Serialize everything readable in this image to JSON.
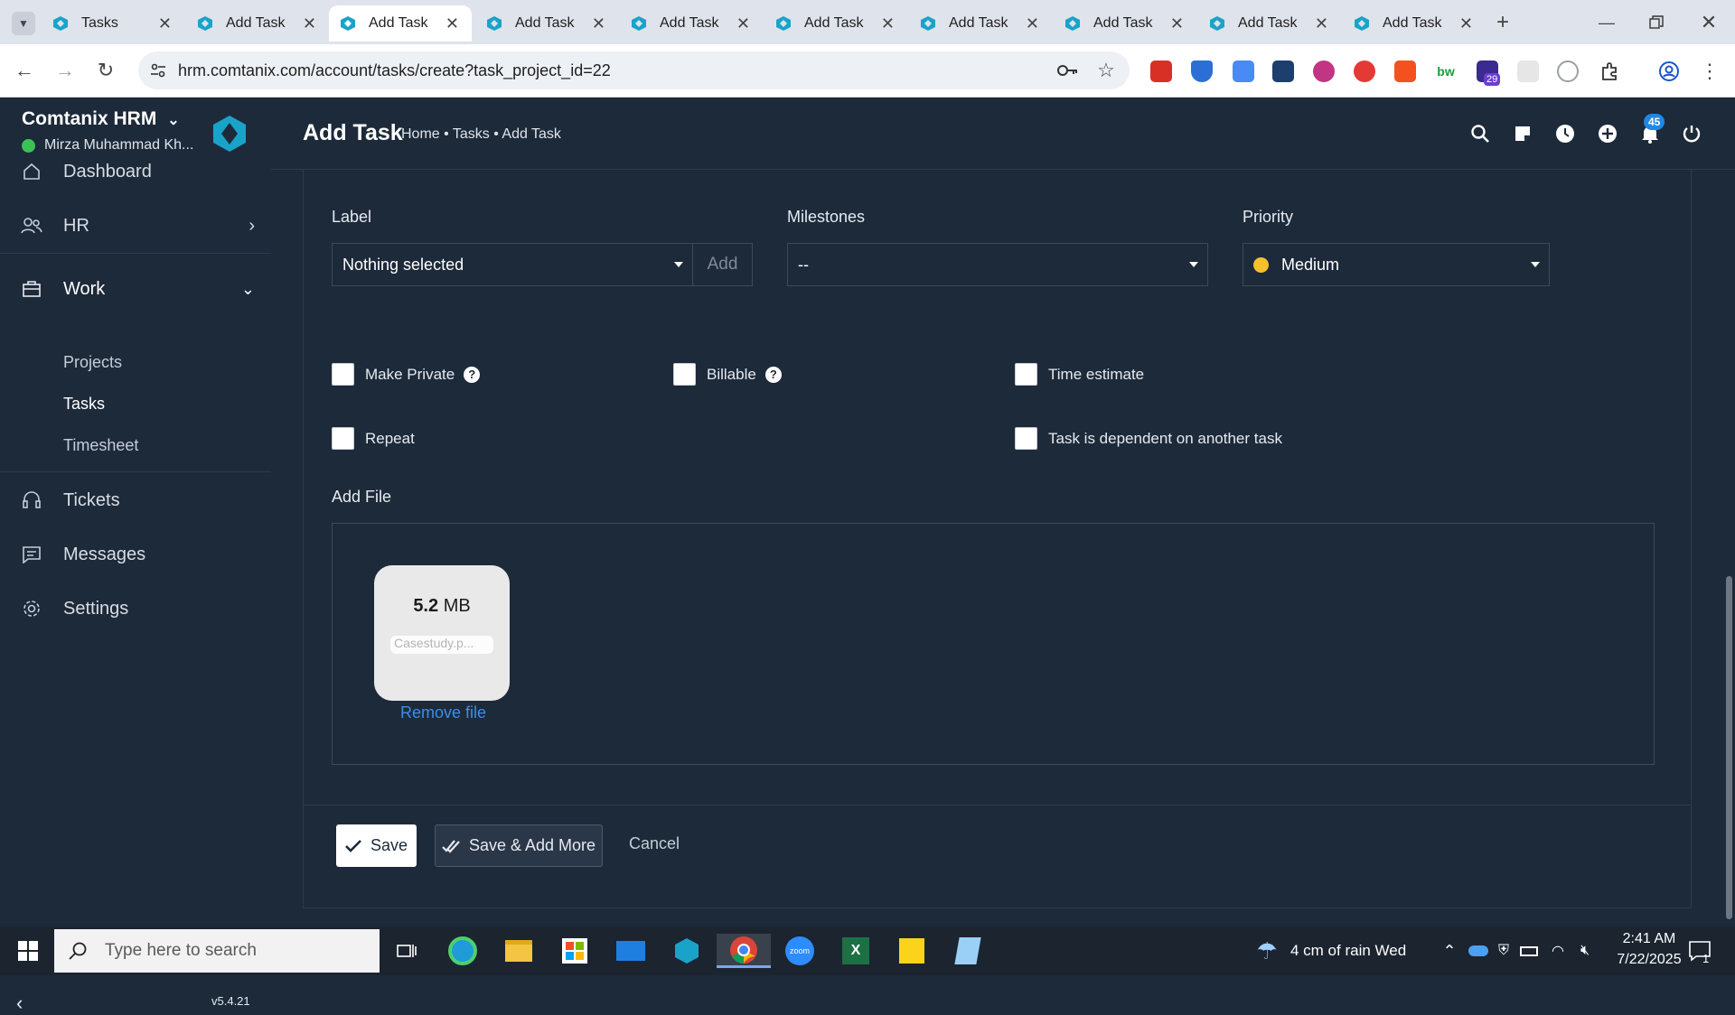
{
  "browser": {
    "tabs": [
      {
        "label": "Tasks",
        "active": false
      },
      {
        "label": "Add Task",
        "active": false
      },
      {
        "label": "Add Task",
        "active": true
      },
      {
        "label": "Add Task",
        "active": false
      },
      {
        "label": "Add Task",
        "active": false
      },
      {
        "label": "Add Task",
        "active": false
      },
      {
        "label": "Add Task",
        "active": false
      },
      {
        "label": "Add Task",
        "active": false
      },
      {
        "label": "Add Task",
        "active": false
      },
      {
        "label": "Add Task",
        "active": false
      }
    ],
    "url": "hrm.comtanix.com/account/tasks/create?task_project_id=22",
    "extension_badge": "29"
  },
  "sidebar": {
    "brand": "Comtanix HRM",
    "user": "Mirza Muhammad Kh...",
    "items": [
      {
        "label": "Dashboard"
      },
      {
        "label": "HR"
      },
      {
        "label": "Work"
      },
      {
        "label": "Tickets"
      },
      {
        "label": "Messages"
      },
      {
        "label": "Settings"
      }
    ],
    "work_sub": [
      {
        "label": "Projects"
      },
      {
        "label": "Tasks"
      },
      {
        "label": "Timesheet"
      }
    ],
    "version": "v5.4.21"
  },
  "header": {
    "title": "Add Task",
    "breadcrumb": "Home • Tasks • Add Task",
    "notification_count": "45"
  },
  "form": {
    "label_field": {
      "label": "Label",
      "value": "Nothing selected",
      "add_button": "Add"
    },
    "milestones_field": {
      "label": "Milestones",
      "value": "--"
    },
    "priority_field": {
      "label": "Priority",
      "value": "Medium",
      "dot_color": "#f6c12b"
    },
    "checkboxes": {
      "make_private": "Make Private",
      "billable": "Billable",
      "time_estimate": "Time estimate",
      "repeat": "Repeat",
      "dependent": "Task is dependent on another task"
    },
    "add_file": {
      "label": "Add File",
      "file_size_num": "5.2",
      "file_size_unit": "MB",
      "file_name": "Casestudy.p...",
      "remove_label": "Remove file"
    },
    "buttons": {
      "save": "Save",
      "save_add": "Save & Add More",
      "cancel": "Cancel"
    }
  },
  "taskbar": {
    "search_placeholder": "Type here to search",
    "weather": "4 cm of rain  Wed",
    "time": "2:41 AM",
    "date": "7/22/2025",
    "notif_count": "1"
  }
}
